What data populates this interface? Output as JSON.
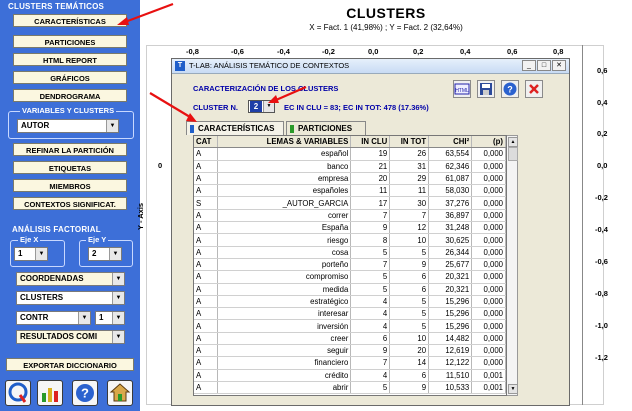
{
  "left_panel": {
    "section_clusters": "CLUSTERS TEMÁTICOS",
    "btn_caracteristicas": "CARACTERÍSTICAS",
    "btn_particiones": "PARTICIONES",
    "btn_html_report": "HTML REPORT",
    "btn_graficos": "GRÁFICOS",
    "btn_dendrograma": "DENDROGRAMA",
    "variables_legend": "VARIABLES Y CLUSTERS",
    "variable_select": "AUTOR",
    "btn_refinar": "REFINAR LA PARTICIÓN",
    "btn_etiquetas": "ETIQUETAS",
    "btn_miembros": "MIEMBROS",
    "btn_contextos": "CONTEXTOS SIGNIFICAT.",
    "section_factorial": "ANÁLISIS FACTORIAL",
    "eje_x_label": "Eje X",
    "eje_x_value": "1",
    "eje_y_label": "Eje Y",
    "eje_y_value": "2",
    "select_coordenadas": "COORDENADAS",
    "select_clusters": "CLUSTERS",
    "select_contr": "CONTR",
    "select_contr_num": "1",
    "select_resultados": "RESULTADOS COMI",
    "btn_exportar": "EXPORTAR DICCIONARIO",
    "icons": [
      "q-logo-icon",
      "chart-icon",
      "help-icon",
      "home-icon"
    ]
  },
  "chart": {
    "title": "CLUSTERS",
    "axis_info": "X = Fact. 1 (41,98%) ; Y = Fact. 2 (32,64%)",
    "x_ticks": [
      "-0,8",
      "-0,6",
      "-0,4",
      "-0,2",
      "0,0",
      "0,2",
      "0,4",
      "0,6",
      "0,8"
    ],
    "y_ticks": [
      "0,6",
      "0,4",
      "0,2",
      "0,0",
      "-0,2",
      "-0,4",
      "-0,6",
      "-0,8",
      "-1,0",
      "-1,2"
    ],
    "y_axis_label": "Y - Axis",
    "left_zero": "0"
  },
  "dialog": {
    "title": "T-LAB: ANÁLISIS TEMÁTICO DE CONTEXTOS",
    "heading": "CARACTERIZACIÓN DE LOS CLUSTERS",
    "cluster_label": "CLUSTER N.",
    "cluster_value": "2",
    "cluster_info": "EC IN CLU = 83; EC IN TOT: 478 (17.36%)",
    "tab_caracteristicas": "CARACTERÍSTICAS",
    "tab_particiones": "PARTICIONES",
    "columns": [
      "CAT",
      "LEMAS & VARIABLES",
      "IN CLU",
      "IN TOT",
      "CHI²",
      "(p)"
    ],
    "rows": [
      [
        "A",
        "español",
        "19",
        "26",
        "63,554",
        "0,000"
      ],
      [
        "A",
        "banco",
        "21",
        "31",
        "62,346",
        "0,000"
      ],
      [
        "A",
        "empresa",
        "20",
        "29",
        "61,087",
        "0,000"
      ],
      [
        "A",
        "españoles",
        "11",
        "11",
        "58,030",
        "0,000"
      ],
      [
        "S",
        "_AUTOR_GARCIA",
        "17",
        "30",
        "37,276",
        "0,000"
      ],
      [
        "A",
        "correr",
        "7",
        "7",
        "36,897",
        "0,000"
      ],
      [
        "A",
        "España",
        "9",
        "12",
        "31,248",
        "0,000"
      ],
      [
        "A",
        "riesgo",
        "8",
        "10",
        "30,625",
        "0,000"
      ],
      [
        "A",
        "cosa",
        "5",
        "5",
        "26,344",
        "0,000"
      ],
      [
        "A",
        "porteño",
        "7",
        "9",
        "25,677",
        "0,000"
      ],
      [
        "A",
        "compromiso",
        "5",
        "6",
        "20,321",
        "0,000"
      ],
      [
        "A",
        "medida",
        "5",
        "6",
        "20,321",
        "0,000"
      ],
      [
        "A",
        "estratégico",
        "4",
        "5",
        "15,296",
        "0,000"
      ],
      [
        "A",
        "interesar",
        "4",
        "5",
        "15,296",
        "0,000"
      ],
      [
        "A",
        "inversión",
        "4",
        "5",
        "15,296",
        "0,000"
      ],
      [
        "A",
        "creer",
        "6",
        "10",
        "14,482",
        "0,000"
      ],
      [
        "A",
        "seguir",
        "9",
        "20",
        "12,619",
        "0,000"
      ],
      [
        "A",
        "financiero",
        "7",
        "14",
        "12,122",
        "0,000"
      ],
      [
        "A",
        "crédito",
        "4",
        "6",
        "11,510",
        "0,001"
      ],
      [
        "A",
        "abrir",
        "5",
        "9",
        "10,533",
        "0,001"
      ]
    ]
  }
}
